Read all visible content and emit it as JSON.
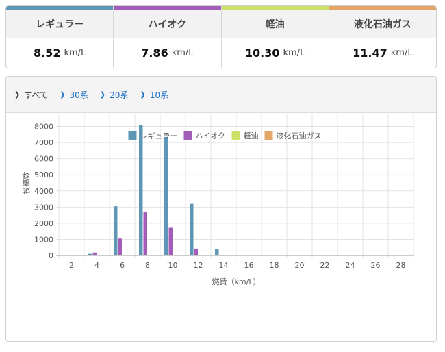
{
  "fuels": [
    {
      "name": "レギュラー",
      "value": "8.52",
      "unit": "km/L",
      "color": "#5e97b5"
    },
    {
      "name": "ハイオク",
      "value": "7.86",
      "unit": "km/L",
      "color": "#a35db8"
    },
    {
      "name": "軽油",
      "value": "10.30",
      "unit": "km/L",
      "color": "#cde068"
    },
    {
      "name": "液化石油ガス",
      "value": "11.47",
      "unit": "km/L",
      "color": "#e1a668"
    }
  ],
  "filters": [
    {
      "label": "すべて",
      "active": true
    },
    {
      "label": "30系",
      "active": false
    },
    {
      "label": "20系",
      "active": false
    },
    {
      "label": "10系",
      "active": false
    }
  ],
  "chart_data": {
    "type": "bar",
    "categories": [
      "2",
      "4",
      "6",
      "8",
      "10",
      "12",
      "14",
      "16",
      "18",
      "20",
      "22",
      "24",
      "26",
      "28"
    ],
    "series": [
      {
        "name": "レギュラー",
        "color": "#5e97b5",
        "values": [
          40,
          100,
          3050,
          8100,
          7350,
          3200,
          380,
          40,
          10,
          0,
          0,
          0,
          0,
          0
        ]
      },
      {
        "name": "ハイオク",
        "color": "#a35db8",
        "values": [
          0,
          180,
          1050,
          2720,
          1720,
          430,
          0,
          0,
          0,
          0,
          0,
          0,
          0,
          0
        ]
      },
      {
        "name": "軽油",
        "color": "#cde068",
        "values": [
          0,
          0,
          0,
          0,
          0,
          0,
          0,
          0,
          0,
          0,
          0,
          0,
          0,
          0
        ]
      },
      {
        "name": "液化石油ガス",
        "color": "#e1a668",
        "values": [
          0,
          0,
          0,
          0,
          0,
          0,
          0,
          0,
          0,
          0,
          0,
          0,
          0,
          0
        ]
      }
    ],
    "xlabel": "燃費（km/L）",
    "ylabel": "投稿数",
    "ylim": [
      0,
      9000
    ],
    "ytick_step": 1000,
    "grid": true,
    "legend": "top-center"
  }
}
